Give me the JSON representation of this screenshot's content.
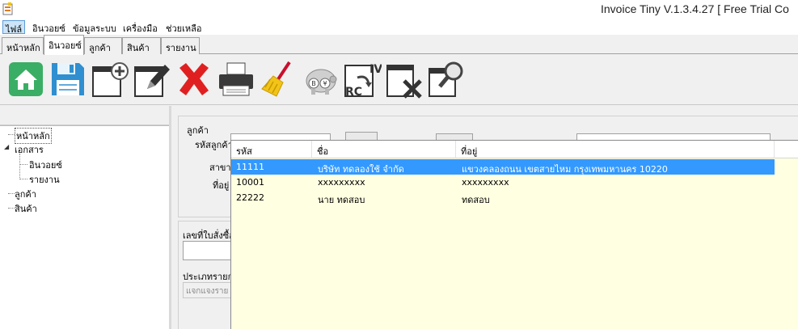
{
  "window": {
    "title": "Invoice Tiny   V.1.3.4.27 [ Free Trial Co"
  },
  "menu": [
    "ไฟล์",
    "อินวอยซ์",
    "ข้อมูลระบบ",
    "เครื่องมือ",
    "ช่วยเหลือ"
  ],
  "tabs": [
    "หน้าหลัก",
    "อินวอยซ์",
    "ลูกค้า",
    "สินค้า",
    "รายงาน"
  ],
  "active_tab": "อินวอยซ์",
  "toolbar": {
    "buttons": [
      "home-icon",
      "save-icon",
      "new-document-icon",
      "edit-icon",
      "delete-icon",
      "print-icon",
      "clear-icon",
      "piggy-bank-icon",
      "convert-icon",
      "cancel-document-icon",
      "search-document-icon"
    ]
  },
  "tree": {
    "home": "หน้าหลัก",
    "documents": "เอกสาร",
    "invoice": "อินวอยซ์",
    "report": "รายงาน",
    "customer": "ลูกค้า",
    "product": "สินค้า",
    "expand_symbol": "◢"
  },
  "form": {
    "customer_group": "ลูกค้า",
    "customer_code_label": "รหัสลูกค้า",
    "branch_label": "สาขา",
    "address_label": "ที่อยู่",
    "po_number_label": "เลขที่ใบสั่งซื้อ",
    "item_type_label": "ประเภทรายก",
    "item_type_value": "แจกแจงราย"
  },
  "grid": {
    "columns": [
      "รหัส",
      "ชื่อ",
      "ที่อยู่"
    ],
    "rows": [
      {
        "code": "11111",
        "name": "บริษัท ทดลองใช้ จำกัด",
        "address": "แขวงคลองถนน เขตสายไหม กรุงเทพมหานคร 10220",
        "selected": true
      },
      {
        "code": "10001",
        "name": "xxxxxxxxx",
        "address": "xxxxxxxxx",
        "selected": false
      },
      {
        "code": "22222",
        "name": "นาย ทดสอบ",
        "address": "ทดสอบ",
        "selected": false
      }
    ]
  },
  "colors": {
    "selection": "#3399ff",
    "popup_bg": "#ffffe1",
    "home_green": "#3aae64",
    "save_blue": "#2f8fd0",
    "delete_red": "#e02020"
  }
}
